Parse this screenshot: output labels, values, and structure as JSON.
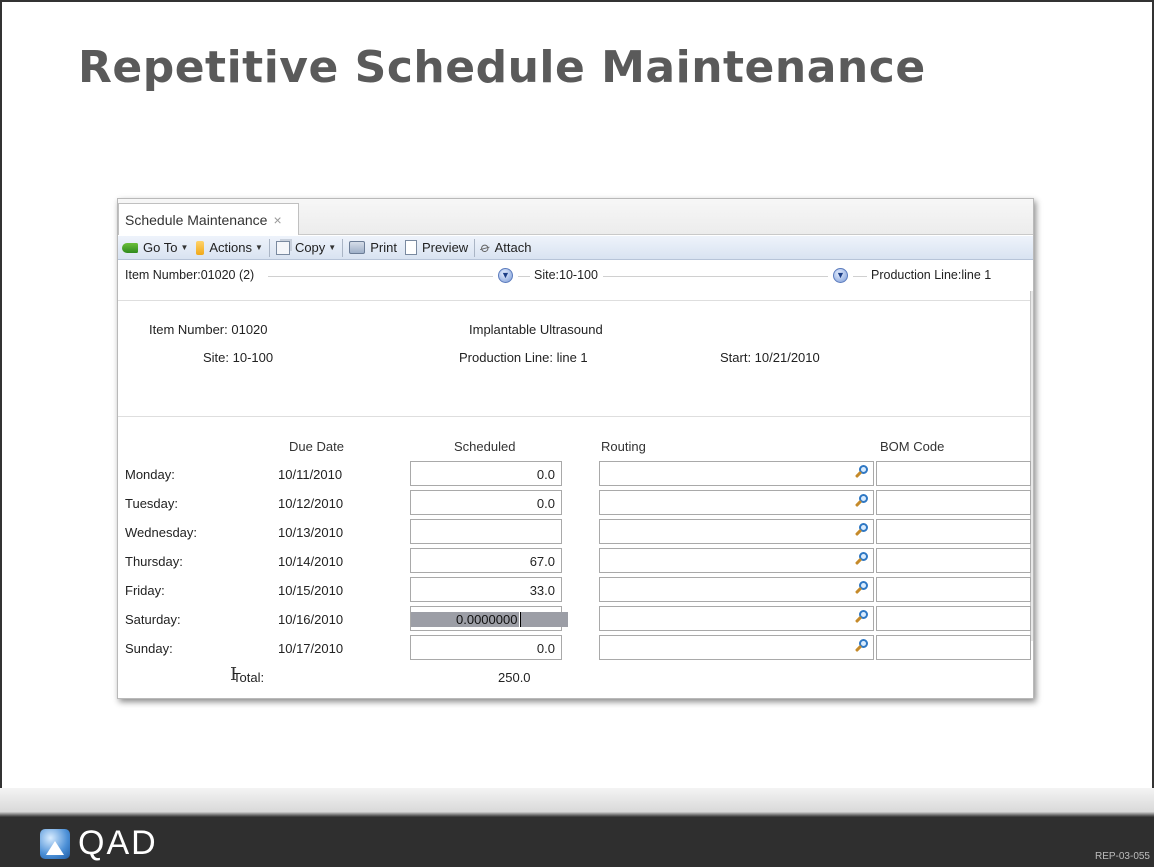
{
  "slide": {
    "title": "Repetitive Schedule Maintenance",
    "code": "REP-03-055",
    "logo_text": "QAD"
  },
  "tab": {
    "label": "Schedule Maintenance",
    "close": "×"
  },
  "toolbar": {
    "goto": "Go To",
    "actions": "Actions",
    "copy": "Copy",
    "print": "Print",
    "preview": "Preview",
    "attach": "Attach"
  },
  "header": {
    "item_number": "Item Number:01020 (2)",
    "site": "Site:10-100",
    "production_line": "Production Line:line 1"
  },
  "info": {
    "item_number": "Item Number:  01020",
    "description": "Implantable Ultrasound",
    "site": "Site:  10-100",
    "production_line": "Production Line:  line 1",
    "start": "Start:  10/21/2010"
  },
  "columns": {
    "due_date": "Due Date",
    "scheduled": "Scheduled",
    "routing": "Routing",
    "bom_code": "BOM Code"
  },
  "rows": [
    {
      "day": "Monday:",
      "date": "10/11/2010",
      "scheduled": "0.0"
    },
    {
      "day": "Tuesday:",
      "date": "10/12/2010",
      "scheduled": "0.0"
    },
    {
      "day": "Wednesday:",
      "date": "10/13/2010",
      "scheduled": ""
    },
    {
      "day": "Thursday:",
      "date": "10/14/2010",
      "scheduled": "67.0"
    },
    {
      "day": "Friday:",
      "date": "10/15/2010",
      "scheduled": "33.0"
    },
    {
      "day": "Saturday:",
      "date": "10/16/2010",
      "scheduled": "0.0000000"
    },
    {
      "day": "Sunday:",
      "date": "10/17/2010",
      "scheduled": "0.0"
    }
  ],
  "total": {
    "label": "Total:",
    "value": "250.0"
  },
  "colors": {
    "title_gray": "#5a5a5a",
    "toolbar_blue": "#d9e3f1",
    "selection_gray": "#9c9ea6",
    "footer_dark": "#2f2f2f"
  }
}
